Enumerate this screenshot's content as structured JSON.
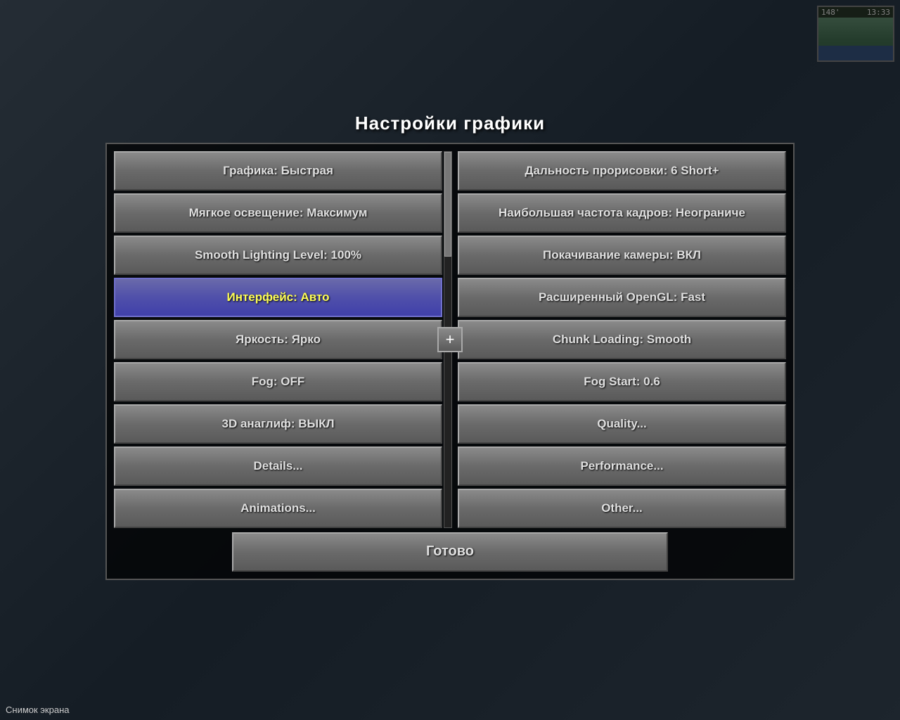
{
  "minimap": {
    "distance": "148'",
    "time": "13:33"
  },
  "modal": {
    "title": "Настройки графики",
    "left_buttons": [
      {
        "id": "graphics",
        "label": "Графика: Быстрая",
        "active": false
      },
      {
        "id": "soft-lighting",
        "label": "Мягкое освещение: Максимум",
        "active": false
      },
      {
        "id": "smooth-level",
        "label": "Smooth Lighting Level: 100%",
        "active": false
      },
      {
        "id": "gui-scale",
        "label": "Интерфейс: Авто",
        "active": true
      },
      {
        "id": "brightness",
        "label": "Яркость: Ярко",
        "active": false
      },
      {
        "id": "fog",
        "label": "Fog: OFF",
        "active": false
      },
      {
        "id": "3d-anaglyph",
        "label": "3D анаглиф: ВЫКЛ",
        "active": false
      },
      {
        "id": "details",
        "label": "Details...",
        "active": false
      },
      {
        "id": "animations",
        "label": "Animations...",
        "active": false
      }
    ],
    "right_buttons": [
      {
        "id": "render-distance",
        "label": "Дальность прорисовки: 6 Short+",
        "active": false
      },
      {
        "id": "max-framerate",
        "label": "Наибольшая частота кадров: Неограниче",
        "active": false
      },
      {
        "id": "camera-bob",
        "label": "Покачивание камеры: ВКЛ",
        "active": false
      },
      {
        "id": "advanced-opengl",
        "label": "Расширенный OpenGL: Fast",
        "active": false
      },
      {
        "id": "chunk-loading",
        "label": "Chunk Loading: Smooth",
        "active": false
      },
      {
        "id": "fog-start",
        "label": "Fog Start: 0.6",
        "active": false
      },
      {
        "id": "quality",
        "label": "Quality...",
        "active": false
      },
      {
        "id": "performance",
        "label": "Performance...",
        "active": false
      },
      {
        "id": "other",
        "label": "Other...",
        "active": false
      }
    ],
    "done_label": "Готово",
    "plus_label": "+"
  },
  "status_bar": {
    "screenshot_text": "Снимок экрана"
  }
}
